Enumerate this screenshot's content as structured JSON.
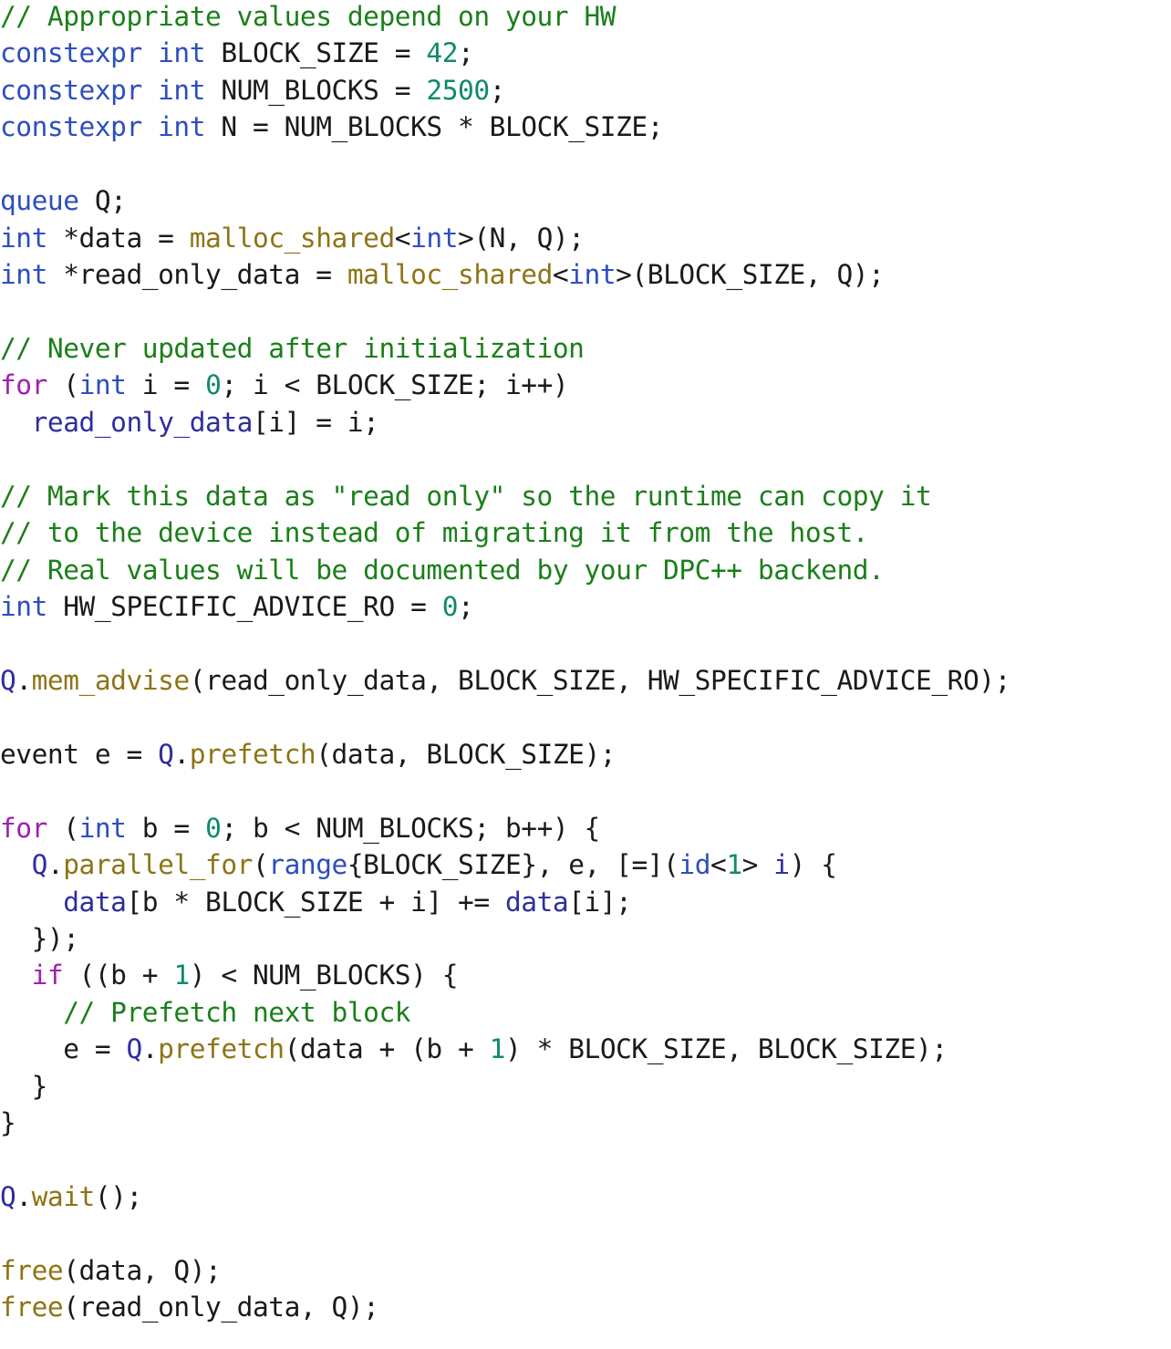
{
  "document": {
    "kind": "source-code-listing",
    "language": "C++ (DPC++ / SYCL)",
    "colors": {
      "background": "#ffffff",
      "plain": "#1a1a1a",
      "comment": "#1a7f1a",
      "keyword": "#2e4ebe",
      "number": "#0f8a6e",
      "function": "#8d7416",
      "variable": "#2e2e9e",
      "control": "#a020b0"
    }
  },
  "code": {
    "lines": [
      {
        "id": "l1",
        "tokens": [
          {
            "t": "// Appropriate values depend on your HW",
            "c": "cm"
          }
        ]
      },
      {
        "id": "l2",
        "tokens": [
          {
            "t": "constexpr",
            "c": "kw"
          },
          {
            "t": " ",
            "c": "pl"
          },
          {
            "t": "int",
            "c": "kw"
          },
          {
            "t": " BLOCK_SIZE = ",
            "c": "pl"
          },
          {
            "t": "42",
            "c": "num"
          },
          {
            "t": ";",
            "c": "pl"
          }
        ]
      },
      {
        "id": "l3",
        "tokens": [
          {
            "t": "constexpr",
            "c": "kw"
          },
          {
            "t": " ",
            "c": "pl"
          },
          {
            "t": "int",
            "c": "kw"
          },
          {
            "t": " NUM_BLOCKS = ",
            "c": "pl"
          },
          {
            "t": "2500",
            "c": "num"
          },
          {
            "t": ";",
            "c": "pl"
          }
        ]
      },
      {
        "id": "l4",
        "tokens": [
          {
            "t": "constexpr",
            "c": "kw"
          },
          {
            "t": " ",
            "c": "pl"
          },
          {
            "t": "int",
            "c": "kw"
          },
          {
            "t": " N = NUM_BLOCKS * BLOCK_SIZE;",
            "c": "pl"
          }
        ]
      },
      {
        "id": "l5",
        "tokens": [
          {
            "t": "",
            "c": "pl"
          }
        ]
      },
      {
        "id": "l6",
        "tokens": [
          {
            "t": "queue",
            "c": "kw"
          },
          {
            "t": " Q;",
            "c": "pl"
          }
        ]
      },
      {
        "id": "l7",
        "tokens": [
          {
            "t": "int",
            "c": "kw"
          },
          {
            "t": " *data = ",
            "c": "pl"
          },
          {
            "t": "malloc_shared",
            "c": "fn"
          },
          {
            "t": "<",
            "c": "pl"
          },
          {
            "t": "int",
            "c": "kw"
          },
          {
            "t": ">(N, Q);",
            "c": "pl"
          }
        ]
      },
      {
        "id": "l8",
        "tokens": [
          {
            "t": "int",
            "c": "kw"
          },
          {
            "t": " *read_only_data = ",
            "c": "pl"
          },
          {
            "t": "malloc_shared",
            "c": "fn"
          },
          {
            "t": "<",
            "c": "pl"
          },
          {
            "t": "int",
            "c": "kw"
          },
          {
            "t": ">(BLOCK_SIZE, Q);",
            "c": "pl"
          }
        ]
      },
      {
        "id": "l9",
        "tokens": [
          {
            "t": "",
            "c": "pl"
          }
        ]
      },
      {
        "id": "l10",
        "tokens": [
          {
            "t": "// Never updated after initialization",
            "c": "cm"
          }
        ]
      },
      {
        "id": "l11",
        "tokens": [
          {
            "t": "for",
            "c": "ctl"
          },
          {
            "t": " (",
            "c": "pl"
          },
          {
            "t": "int",
            "c": "kw"
          },
          {
            "t": " i = ",
            "c": "pl"
          },
          {
            "t": "0",
            "c": "num"
          },
          {
            "t": "; i < BLOCK_SIZE; i++)",
            "c": "pl"
          }
        ]
      },
      {
        "id": "l12",
        "tokens": [
          {
            "t": "  ",
            "c": "pl"
          },
          {
            "t": "read_only_data",
            "c": "var"
          },
          {
            "t": "[i] = i;",
            "c": "pl"
          }
        ]
      },
      {
        "id": "l13",
        "tokens": [
          {
            "t": "",
            "c": "pl"
          }
        ]
      },
      {
        "id": "l14",
        "tokens": [
          {
            "t": "// Mark this data as \"read only\" so the runtime can copy it",
            "c": "cm"
          }
        ]
      },
      {
        "id": "l15",
        "tokens": [
          {
            "t": "// to the device instead of migrating it from the host.",
            "c": "cm"
          }
        ]
      },
      {
        "id": "l16",
        "tokens": [
          {
            "t": "// Real values will be documented by your DPC++ backend.",
            "c": "cm"
          }
        ]
      },
      {
        "id": "l17",
        "tokens": [
          {
            "t": "int",
            "c": "kw"
          },
          {
            "t": " HW_SPECIFIC_ADVICE_RO = ",
            "c": "pl"
          },
          {
            "t": "0",
            "c": "num"
          },
          {
            "t": ";",
            "c": "pl"
          }
        ]
      },
      {
        "id": "l18",
        "tokens": [
          {
            "t": "",
            "c": "pl"
          }
        ]
      },
      {
        "id": "l19",
        "tokens": [
          {
            "t": "Q",
            "c": "var"
          },
          {
            "t": ".",
            "c": "pl"
          },
          {
            "t": "mem_advise",
            "c": "fn"
          },
          {
            "t": "(read_only_data, BLOCK_SIZE, HW_SPECIFIC_ADVICE_RO);",
            "c": "pl"
          }
        ]
      },
      {
        "id": "l20",
        "tokens": [
          {
            "t": "",
            "c": "pl"
          }
        ]
      },
      {
        "id": "l21",
        "tokens": [
          {
            "t": "event e = ",
            "c": "pl"
          },
          {
            "t": "Q",
            "c": "var"
          },
          {
            "t": ".",
            "c": "pl"
          },
          {
            "t": "prefetch",
            "c": "fn"
          },
          {
            "t": "(data, BLOCK_SIZE);",
            "c": "pl"
          }
        ]
      },
      {
        "id": "l22",
        "tokens": [
          {
            "t": "",
            "c": "pl"
          }
        ]
      },
      {
        "id": "l23",
        "tokens": [
          {
            "t": "for",
            "c": "ctl"
          },
          {
            "t": " (",
            "c": "pl"
          },
          {
            "t": "int",
            "c": "kw"
          },
          {
            "t": " b = ",
            "c": "pl"
          },
          {
            "t": "0",
            "c": "num"
          },
          {
            "t": "; b < NUM_BLOCKS; b++) {",
            "c": "pl"
          }
        ]
      },
      {
        "id": "l24",
        "tokens": [
          {
            "t": "  ",
            "c": "pl"
          },
          {
            "t": "Q",
            "c": "var"
          },
          {
            "t": ".",
            "c": "pl"
          },
          {
            "t": "parallel_for",
            "c": "fn"
          },
          {
            "t": "(",
            "c": "pl"
          },
          {
            "t": "range",
            "c": "kw"
          },
          {
            "t": "{BLOCK_SIZE}, e, [=](",
            "c": "pl"
          },
          {
            "t": "id",
            "c": "kw"
          },
          {
            "t": "<",
            "c": "pl"
          },
          {
            "t": "1",
            "c": "num"
          },
          {
            "t": "> ",
            "c": "pl"
          },
          {
            "t": "i",
            "c": "var"
          },
          {
            "t": ") {",
            "c": "pl"
          }
        ]
      },
      {
        "id": "l25",
        "tokens": [
          {
            "t": "    ",
            "c": "pl"
          },
          {
            "t": "data",
            "c": "var"
          },
          {
            "t": "[b * BLOCK_SIZE + i] += ",
            "c": "pl"
          },
          {
            "t": "data",
            "c": "var"
          },
          {
            "t": "[i];",
            "c": "pl"
          }
        ]
      },
      {
        "id": "l26",
        "tokens": [
          {
            "t": "  });",
            "c": "pl"
          }
        ]
      },
      {
        "id": "l27",
        "tokens": [
          {
            "t": "  ",
            "c": "pl"
          },
          {
            "t": "if",
            "c": "ctl"
          },
          {
            "t": " ((b + ",
            "c": "pl"
          },
          {
            "t": "1",
            "c": "num"
          },
          {
            "t": ") < NUM_BLOCKS) {",
            "c": "pl"
          }
        ]
      },
      {
        "id": "l28",
        "tokens": [
          {
            "t": "    ",
            "c": "pl"
          },
          {
            "t": "// Prefetch next block",
            "c": "cm"
          }
        ]
      },
      {
        "id": "l29",
        "tokens": [
          {
            "t": "    e = ",
            "c": "pl"
          },
          {
            "t": "Q",
            "c": "var"
          },
          {
            "t": ".",
            "c": "pl"
          },
          {
            "t": "prefetch",
            "c": "fn"
          },
          {
            "t": "(data + (b + ",
            "c": "pl"
          },
          {
            "t": "1",
            "c": "num"
          },
          {
            "t": ") * BLOCK_SIZE, BLOCK_SIZE);",
            "c": "pl"
          }
        ]
      },
      {
        "id": "l30",
        "tokens": [
          {
            "t": "  }",
            "c": "pl"
          }
        ]
      },
      {
        "id": "l31",
        "tokens": [
          {
            "t": "}",
            "c": "pl"
          }
        ]
      },
      {
        "id": "l32",
        "tokens": [
          {
            "t": "",
            "c": "pl"
          }
        ]
      },
      {
        "id": "l33",
        "tokens": [
          {
            "t": "Q",
            "c": "var"
          },
          {
            "t": ".",
            "c": "pl"
          },
          {
            "t": "wait",
            "c": "fn"
          },
          {
            "t": "();",
            "c": "pl"
          }
        ]
      },
      {
        "id": "l34",
        "tokens": [
          {
            "t": "",
            "c": "pl"
          }
        ]
      },
      {
        "id": "l35",
        "tokens": [
          {
            "t": "free",
            "c": "fn"
          },
          {
            "t": "(data, Q);",
            "c": "pl"
          }
        ]
      },
      {
        "id": "l36",
        "tokens": [
          {
            "t": "free",
            "c": "fn"
          },
          {
            "t": "(read_only_data, Q);",
            "c": "pl"
          }
        ]
      }
    ]
  }
}
